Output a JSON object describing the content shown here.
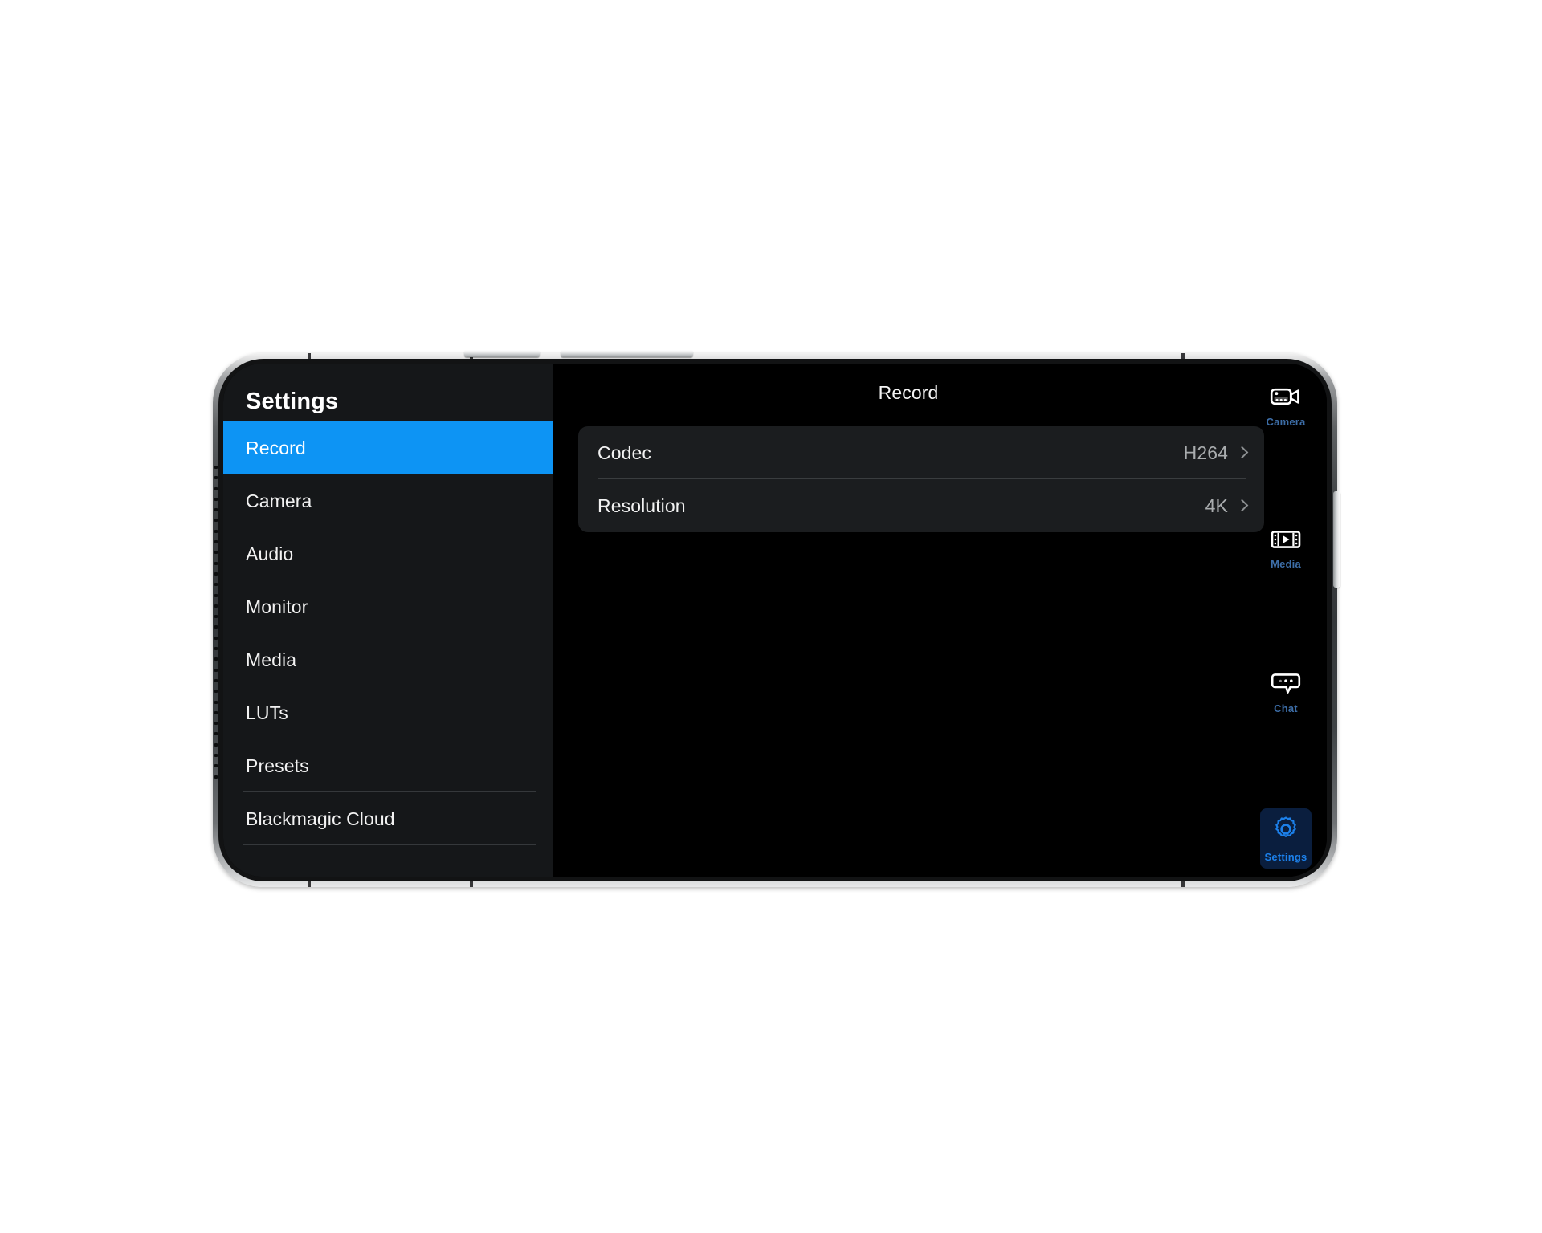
{
  "app": {
    "sidebar": {
      "title": "Settings",
      "items": [
        {
          "label": "Record",
          "active": true
        },
        {
          "label": "Camera",
          "active": false
        },
        {
          "label": "Audio",
          "active": false
        },
        {
          "label": "Monitor",
          "active": false
        },
        {
          "label": "Media",
          "active": false
        },
        {
          "label": "LUTs",
          "active": false
        },
        {
          "label": "Presets",
          "active": false
        },
        {
          "label": "Blackmagic Cloud",
          "active": false
        }
      ]
    },
    "main": {
      "title": "Record",
      "rows": [
        {
          "label": "Codec",
          "value": "H264",
          "chevron": "chevron-right-icon"
        },
        {
          "label": "Resolution",
          "value": "4K",
          "chevron": "chevron-right-icon"
        }
      ]
    },
    "rail": [
      {
        "label": "Camera",
        "icon": "video-camera-icon",
        "active": false
      },
      {
        "label": "Media",
        "icon": "film-strip-play-icon",
        "active": false
      },
      {
        "label": "Chat",
        "icon": "speech-bubble-icon",
        "active": false
      },
      {
        "label": "Settings",
        "icon": "gear-icon",
        "active": true
      }
    ],
    "colors": {
      "accent_blue": "#0d94f4",
      "active_rail_blue": "#1c80ea",
      "rail_label_blue": "#3d6ea8",
      "sidebar_bg": "#151719",
      "card_bg": "#1b1d1f",
      "screen_bg": "#000000",
      "value_gray": "#a9acae"
    }
  },
  "device": {
    "type": "smartphone-landscape",
    "buttons": [
      "volume-up-button",
      "volume-down-button",
      "power-button"
    ],
    "features": [
      "front-camera-lens",
      "speaker-grille",
      "antenna-lines"
    ]
  }
}
